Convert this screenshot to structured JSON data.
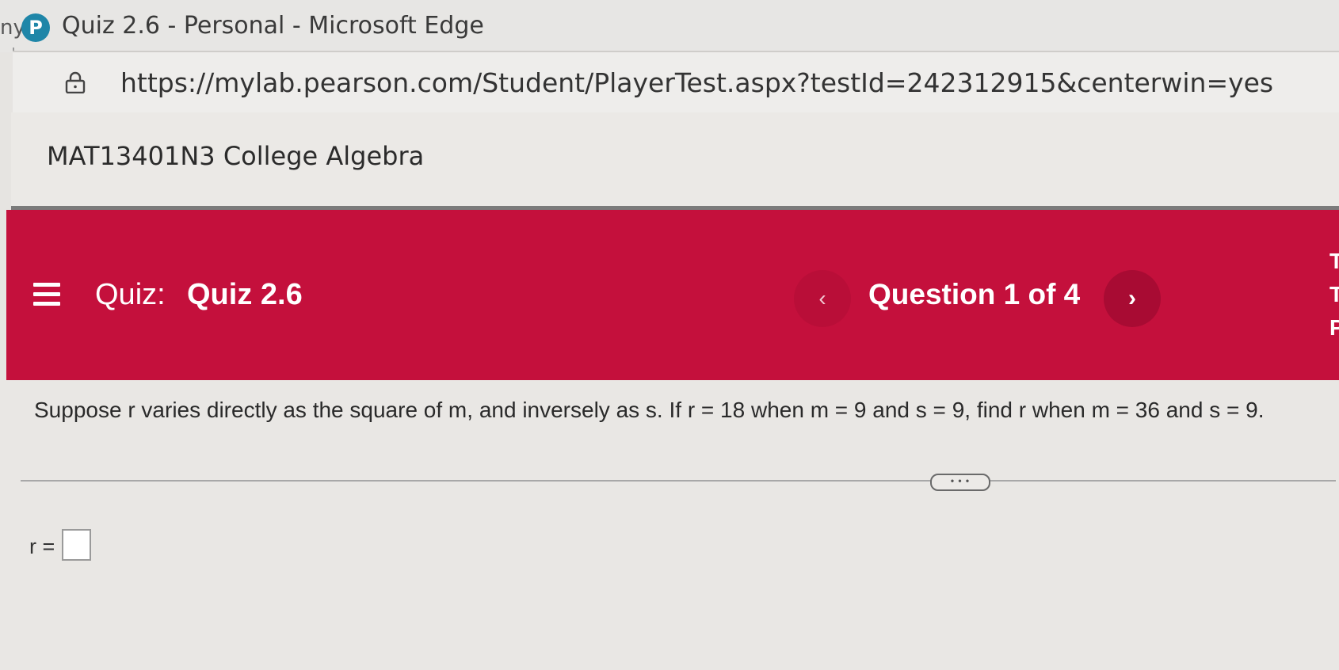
{
  "window": {
    "left_edge_text": "ny",
    "app_icon_letter": "P",
    "title": "Quiz 2.6 - Personal - Microsoft Edge"
  },
  "address_bar": {
    "url": "https://mylab.pearson.com/Student/PlayerTest.aspx?testId=242312915&centerwin=yes"
  },
  "course": {
    "title": "MAT13401N3 College Algebra"
  },
  "quiz_banner": {
    "quiz_label": "Quiz:",
    "quiz_name": "Quiz 2.6",
    "prev_label": "‹",
    "question_counter": "Question 1 of 4",
    "next_label": "›",
    "edge_fragment": "T\nT\nP",
    "background_color": "#c4103c"
  },
  "question": {
    "text": "Suppose r varies directly as the square of m, and inversely as s. If r = 18 when m = 9 and s = 9, find r when m = 36 and s = 9.",
    "more_label": "• • •",
    "answer_label": "r =",
    "answer_value": ""
  }
}
